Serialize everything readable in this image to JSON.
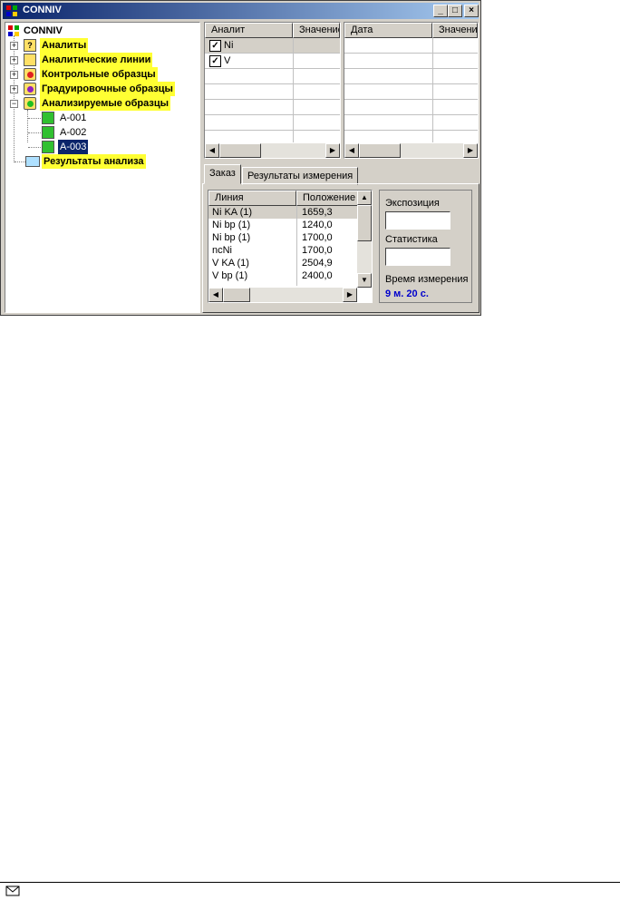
{
  "window": {
    "title": "CONNIV",
    "buttons": [
      "_",
      "□",
      "×"
    ]
  },
  "tree": {
    "root": "CONNIV",
    "items": [
      {
        "label": "Аналиты",
        "icon": "question-folder-icon"
      },
      {
        "label": "Аналитические линии",
        "icon": "chart-folder-icon"
      },
      {
        "label": "Контрольные образцы",
        "icon": "sample-red-icon"
      },
      {
        "label": "Градуировочные образцы",
        "icon": "sample-purple-icon"
      },
      {
        "label": "Анализируемые образцы",
        "icon": "sample-green-icon"
      }
    ],
    "children": [
      "A-001",
      "A-002",
      "A-003"
    ],
    "results": "Результаты анализа"
  },
  "analyte_grid": {
    "headers": [
      "Аналит",
      "Значение"
    ],
    "rows": [
      {
        "name": "Ni",
        "checked": true
      },
      {
        "name": "V",
        "checked": true
      }
    ]
  },
  "date_grid": {
    "headers": [
      "Дата",
      "Значение"
    ]
  },
  "tabs": [
    "Заказ",
    "Результаты измерения"
  ],
  "lines_grid": {
    "headers": [
      "Линия",
      "Положение"
    ],
    "rows": [
      [
        "Ni KA (1)",
        "1659,3"
      ],
      [
        "Ni bp (1)",
        "1240,0"
      ],
      [
        "Ni bp (1)",
        "1700,0"
      ],
      [
        "ncNi",
        "1700,0"
      ],
      [
        "V KA (1)",
        "2504,9"
      ],
      [
        "V bp (1)",
        "2400,0"
      ]
    ]
  },
  "side_panel": {
    "exposure_label": "Экспозиция",
    "statistics_label": "Статистика",
    "time_label": "Время измерения",
    "time_value": "9 м. 20 с."
  },
  "colors": {
    "title_bar": "#0a246a",
    "highlight": "#ffff33",
    "time_value": "#0000cc"
  }
}
